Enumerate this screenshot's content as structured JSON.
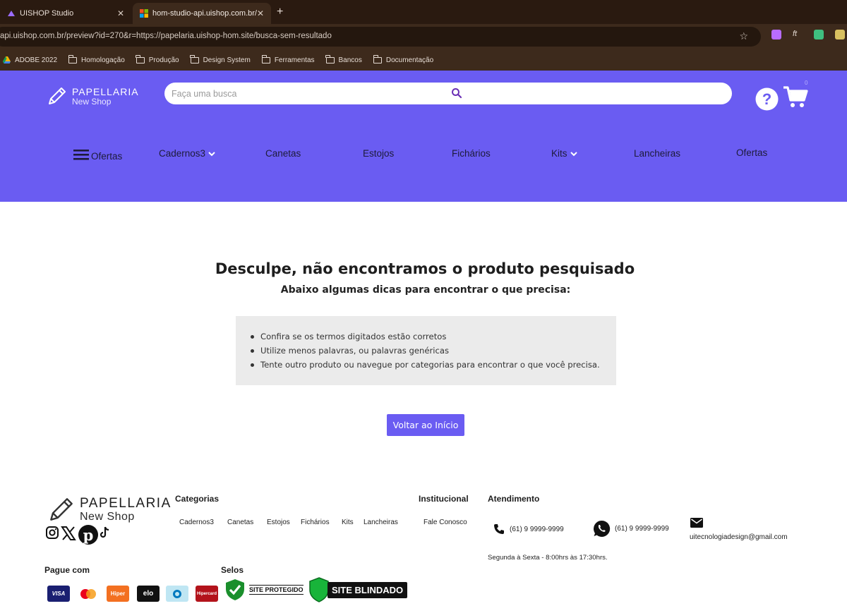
{
  "browser": {
    "tabs": [
      {
        "title": "UISHOP Studio"
      },
      {
        "title": "hom-studio-api.uishop.com.br/"
      }
    ],
    "new_tab": "+",
    "url": "api.uishop.com.br/preview?id=270&r=https://papelaria.uishop-hom.site/busca-sem-resultado",
    "bookmarks": [
      "ADOBE 2022",
      "Homologação",
      "Produção",
      "Design System",
      "Ferramentas",
      "Bancos",
      "Documentação"
    ]
  },
  "header": {
    "logo_main": "PAPELLARIA",
    "logo_sub": "New Shop",
    "search_placeholder": "Faça uma busca",
    "nav": [
      {
        "label": "Ofertas"
      },
      {
        "label": "Cadernos3"
      },
      {
        "label": "Canetas"
      },
      {
        "label": "Estojos"
      },
      {
        "label": "Fichários"
      },
      {
        "label": "Kits"
      },
      {
        "label": "Lancheiras"
      },
      {
        "label": "Ofertas"
      }
    ],
    "colors": {
      "primary": "#6a5cf2"
    }
  },
  "main": {
    "title": "Desculpe, não encontramos o produto pesquisado",
    "subtitle": "Abaixo algumas dicas para encontrar o que precisa:",
    "tips": [
      "Confira se os termos digitados estão corretos",
      "Utilize menos palavras, ou palavras genéricas",
      "Tente outro produto ou navegue por categorias para encontrar o que você precisa."
    ],
    "home_button": "Voltar ao Início"
  },
  "footer": {
    "logo_main": "PAPELLARIA",
    "logo_sub": "New Shop",
    "categories_heading": "Categorias",
    "categories": [
      "Cadernos3",
      "Canetas",
      "Estojos",
      "Fichários",
      "Kits",
      "Lancheiras"
    ],
    "institutional_heading": "Institucional",
    "institutional": [
      "Fale Conosco"
    ],
    "service_heading": "Atendimento",
    "phone": "(61) 9 9999-9999",
    "whatsapp": "(61) 9 9999-9999",
    "email": "uitecnologiadesign@gmail.com",
    "hours": "Segunda à Sexta - 8:00hrs às 17:30hrs.",
    "payment_heading": "Pague com",
    "payments": [
      "VISA",
      "",
      "Hiper",
      "elo",
      "",
      "Hipercard"
    ],
    "seals_heading": "Selos",
    "seal_protected": "SITE PROTEGIDO",
    "seal_blindado": "SITE BLINDADO"
  }
}
